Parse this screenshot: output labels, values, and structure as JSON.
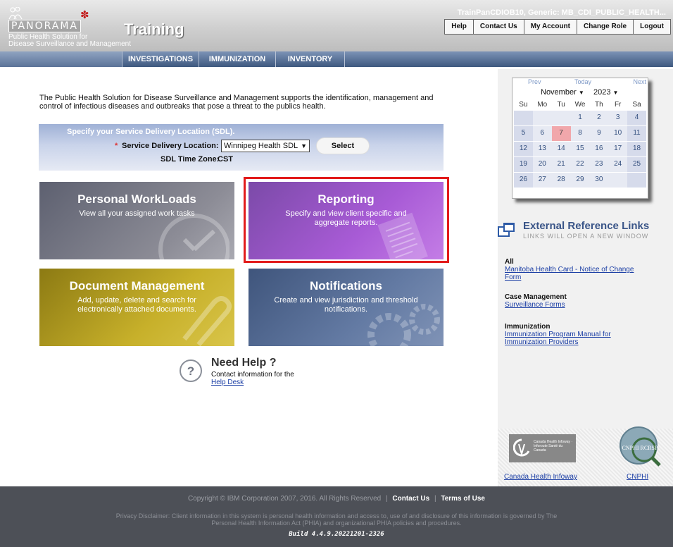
{
  "header": {
    "logo_text": "PANORAMA",
    "logo_tagline_1": "Public Health Solution for",
    "logo_tagline_2": "Disease Surveillance and Management",
    "app_title": "Training",
    "user_info": "TrainPanCDIOB10, Generic: MB_CDI_PUBLIC_HEALTH...",
    "top_nav": [
      "Help",
      "Contact Us",
      "My Account",
      "Change Role",
      "Logout"
    ]
  },
  "main_nav": [
    "INVESTIGATIONS",
    "IMMUNIZATION",
    "INVENTORY"
  ],
  "intro_text": "The Public Health Solution for Disease Surveillance and Management supports the identification, management and control of infectious diseases and outbreaks that pose a threat to the publics health.",
  "sdl": {
    "title": "Specify your Service Delivery Location (SDL).",
    "required_mark": "*",
    "location_label": "Service Delivery Location:",
    "location_value": "Winnipeg Health SDL",
    "select_button": "Select",
    "timezone_label": "SDL Time Zone:",
    "timezone_value": "CST"
  },
  "tiles": {
    "workloads": {
      "title": "Personal WorkLoads",
      "desc": "View all your assigned work tasks"
    },
    "reporting": {
      "title": "Reporting",
      "desc": "Specify and view client specific and aggregate reports."
    },
    "documents": {
      "title": "Document Management",
      "desc": "Add, update, delete and search for electronically attached documents."
    },
    "notifications": {
      "title": "Notifications",
      "desc": "Create and view jurisdiction and threshold notifications."
    }
  },
  "help": {
    "title": "Need Help ?",
    "text": "Contact information for the",
    "link": "Help Desk"
  },
  "calendar": {
    "prev": "Prev",
    "today": "Today",
    "next": "Next",
    "month": "November",
    "year": "2023",
    "weekdays": [
      "Su",
      "Mo",
      "Tu",
      "We",
      "Th",
      "Fr",
      "Sa"
    ],
    "weeks": [
      [
        "",
        "",
        "",
        "1",
        "2",
        "3",
        "4"
      ],
      [
        "5",
        "6",
        "7",
        "8",
        "9",
        "10",
        "11"
      ],
      [
        "12",
        "13",
        "14",
        "15",
        "16",
        "17",
        "18"
      ],
      [
        "19",
        "20",
        "21",
        "22",
        "23",
        "24",
        "25"
      ],
      [
        "26",
        "27",
        "28",
        "29",
        "30",
        "",
        ""
      ]
    ],
    "highlighted_day": "7"
  },
  "external_links": {
    "title": "External Reference Links",
    "subtitle": "LINKS WILL OPEN A NEW WINDOW",
    "groups": [
      {
        "title": "All",
        "links": [
          "Manitoba Health Card - Notice of Change",
          "Form"
        ]
      },
      {
        "title": "Case Management",
        "links": [
          "Surveillance Forms"
        ]
      },
      {
        "title": "Immunization",
        "links": [
          "Immunization Program Manual for",
          "Immunization Providers"
        ]
      }
    ]
  },
  "partners": {
    "canada_logo_text": "Canada Health Infoway · Inforoute Santé du Canada",
    "cnphi_logo_text": "CNPHI RCRSP",
    "canada_link": "Canada Health Infoway",
    "cnphi_link": "CNPHI"
  },
  "footer": {
    "copyright": "Copyright © IBM Corporation 2007, 2016. All Rights Reserved",
    "separator": "|",
    "contact_us": "Contact Us",
    "terms": "Terms of Use",
    "disclaimer": "Privacy Disclaimer: Client information in this system is personal health information and access to, use of and disclosure of this information is governed by The Personal Health Information Act (PHIA) and organizational PHIA policies and procedures.",
    "build": "Build 4.4.9.20221201-2326"
  },
  "colors": {
    "highlight_border": "#e21b1b",
    "link": "#1b3ea5",
    "footer_bg": "#4d5057"
  }
}
